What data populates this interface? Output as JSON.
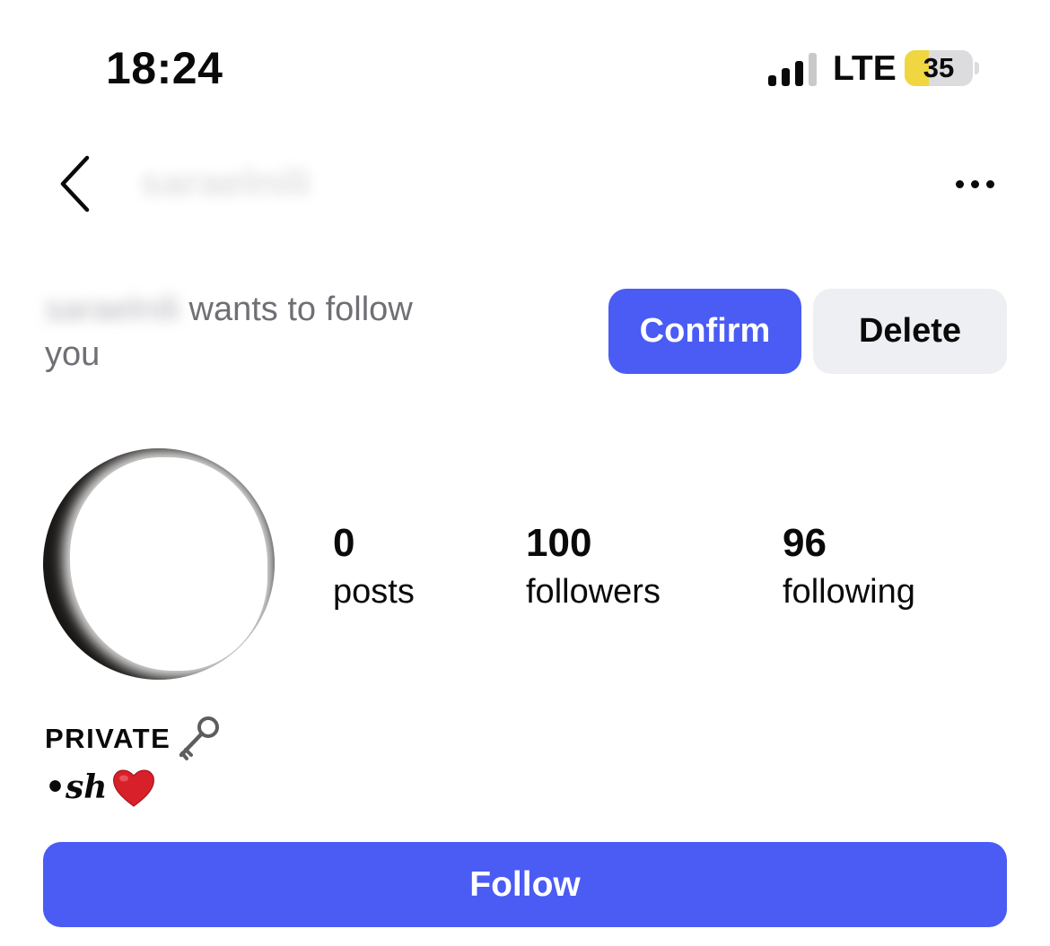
{
  "status_bar": {
    "time": "18:24",
    "network": "LTE",
    "signal_bars_active": 3,
    "signal_bars_total": 4,
    "battery_level": "35",
    "battery_fill_fraction": 0.35,
    "battery_color": "#f0d640"
  },
  "header": {
    "back_icon": "chevron-left-icon",
    "username": "saraelnili",
    "more_icon": "more-horizontal-icon"
  },
  "follow_request": {
    "username": "saraelnili",
    "text": "wants to follow you",
    "confirm_label": "Confirm",
    "delete_label": "Delete"
  },
  "profile": {
    "stats": [
      {
        "value": "0",
        "label": "posts"
      },
      {
        "value": "100",
        "label": "followers"
      },
      {
        "value": "96",
        "label": "following"
      }
    ]
  },
  "bio": {
    "line1_text": "PRIVATE",
    "line1_icon": "key-icon",
    "line2_text": "•sh",
    "line2_icon": "red-heart-icon"
  },
  "actions": {
    "follow_label": "Follow"
  },
  "colors": {
    "accent": "#4a5cf3",
    "secondary_button": "#eeeff2",
    "muted_text": "#6f6f75"
  }
}
